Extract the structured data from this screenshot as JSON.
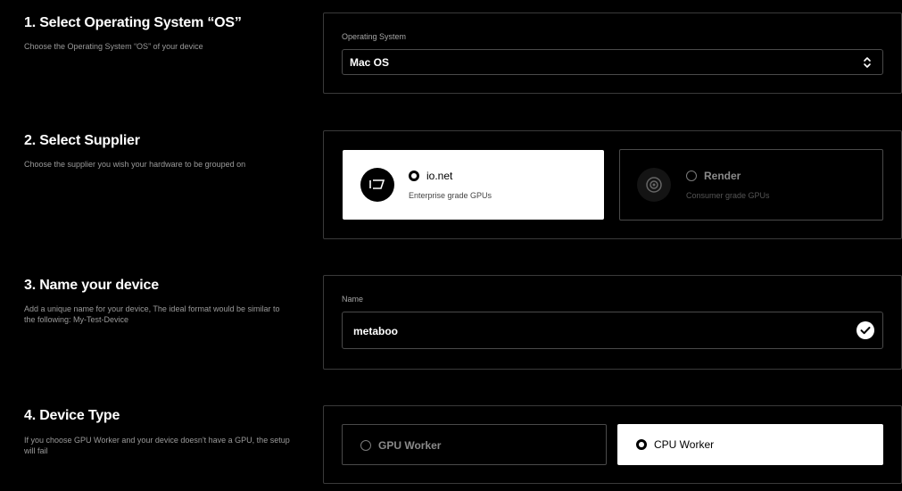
{
  "os_section": {
    "title": "1. Select Operating System “OS”",
    "description": "Choose the Operating System “OS” of your device",
    "field_label": "Operating System",
    "selected_value": "Mac OS"
  },
  "supplier_section": {
    "title": "2. Select Supplier",
    "description": "Choose the supplier you wish your hardware to be grouped on",
    "options": [
      {
        "name": "io.net",
        "subtitle": "Enterprise grade GPUs",
        "selected": true,
        "logo_icon": "io-net-logo"
      },
      {
        "name": "Render",
        "subtitle": "Consumer grade GPUs",
        "selected": false,
        "logo_icon": "render-logo"
      }
    ]
  },
  "name_section": {
    "title": "3. Name your device",
    "description": "Add a unique name for your device, The ideal format would be similar to the following: My-Test-Device",
    "field_label": "Name",
    "value": "metaboo"
  },
  "device_type_section": {
    "title": "4. Device Type",
    "description": "If you choose GPU Worker and your device doesn't have a GPU, the setup will fail",
    "options": [
      {
        "name": "GPU Worker",
        "selected": false
      },
      {
        "name": "CPU Worker",
        "selected": true
      }
    ]
  },
  "colors": {
    "background": "#000000",
    "border": "#3a3a3a",
    "selected_bg": "#ffffff",
    "muted_text": "#9a9a9a"
  }
}
